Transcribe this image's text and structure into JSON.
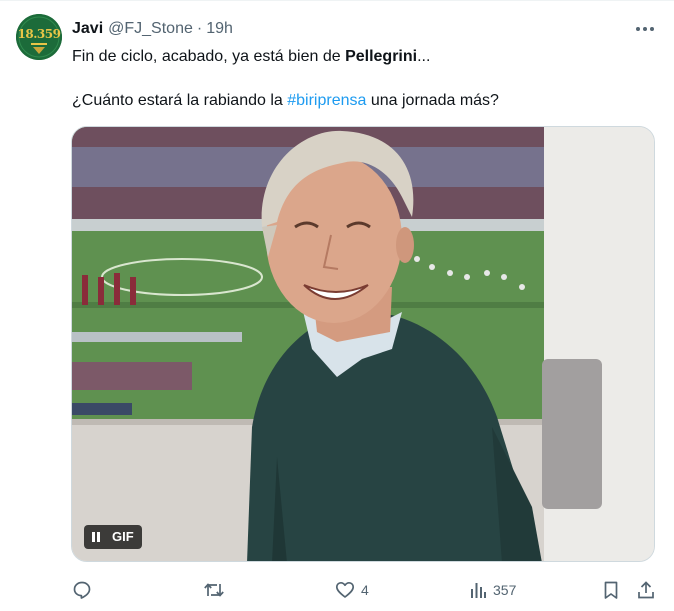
{
  "author": {
    "display_name": "Javi",
    "handle": "@FJ_Stone",
    "separator": "·",
    "time": "19h",
    "avatar_text": "18.359"
  },
  "tweet": {
    "line1_prefix": "Fin de ciclo, acabado, ya está bien de ",
    "line1_bold": "Pellegrini",
    "line1_suffix": "...",
    "line2_prefix": "¿Cuánto estará la rabiando la ",
    "hashtag": "#biriprensa",
    "line2_suffix": " una jornada más?"
  },
  "media": {
    "type": "gif",
    "badge_label": "GIF"
  },
  "actions": {
    "reply_count": "",
    "retweet_count": "",
    "like_count": "4",
    "views_count": "357"
  },
  "icons": [
    "more-icon",
    "pause-icon",
    "reply-icon",
    "retweet-icon",
    "like-icon",
    "views-icon",
    "bookmark-icon",
    "share-icon"
  ],
  "colors": {
    "text_primary": "#0f1419",
    "text_secondary": "#536471",
    "link": "#1d9bf0",
    "avatar_bg": "#1c6b3a",
    "avatar_text": "#e8c547"
  }
}
